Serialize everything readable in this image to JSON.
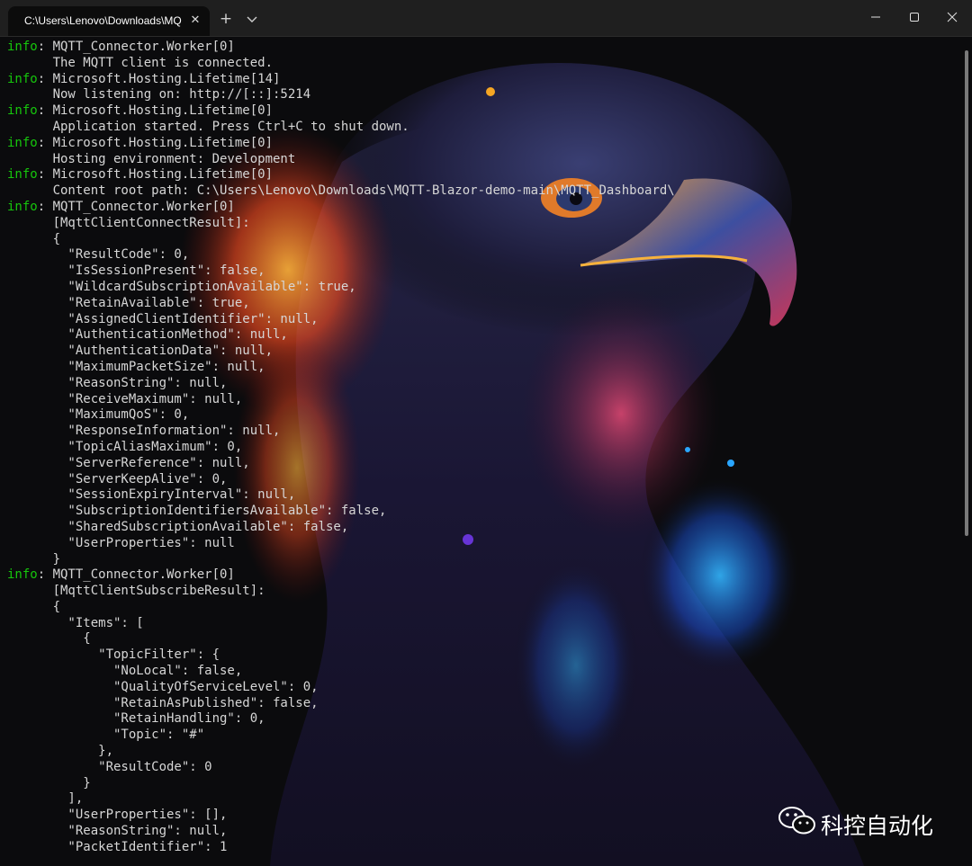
{
  "window": {
    "tab_title": "C:\\Users\\Lenovo\\Downloads\\MQ",
    "tab_close_icon": "close-icon",
    "new_tab_icon": "plus-icon",
    "dropdown_icon": "chevron-down-icon",
    "controls": [
      "minimize-icon",
      "maximize-icon",
      "close-icon"
    ]
  },
  "colors": {
    "titlebar": "#1f1f1f",
    "terminal_bg": "#0b0b0d",
    "log_level": "#16c60c",
    "text": "#d6d6d6"
  },
  "lines": [
    {
      "level": "info",
      "text": ": MQTT_Connector.Worker[0]"
    },
    {
      "level": "",
      "text": "      The MQTT client is connected."
    },
    {
      "level": "info",
      "text": ": Microsoft.Hosting.Lifetime[14]"
    },
    {
      "level": "",
      "text": "      Now listening on: http://[::]:5214"
    },
    {
      "level": "info",
      "text": ": Microsoft.Hosting.Lifetime[0]"
    },
    {
      "level": "",
      "text": "      Application started. Press Ctrl+C to shut down."
    },
    {
      "level": "info",
      "text": ": Microsoft.Hosting.Lifetime[0]"
    },
    {
      "level": "",
      "text": "      Hosting environment: Development"
    },
    {
      "level": "info",
      "text": ": Microsoft.Hosting.Lifetime[0]"
    },
    {
      "level": "",
      "text": "      Content root path: C:\\Users\\Lenovo\\Downloads\\MQTT-Blazor-demo-main\\MQTT_Dashboard\\"
    },
    {
      "level": "info",
      "text": ": MQTT_Connector.Worker[0]"
    },
    {
      "level": "",
      "text": "      [MqttClientConnectResult]:"
    },
    {
      "level": "",
      "text": "      {"
    },
    {
      "level": "",
      "text": "        \"ResultCode\": 0,"
    },
    {
      "level": "",
      "text": "        \"IsSessionPresent\": false,"
    },
    {
      "level": "",
      "text": "        \"WildcardSubscriptionAvailable\": true,"
    },
    {
      "level": "",
      "text": "        \"RetainAvailable\": true,"
    },
    {
      "level": "",
      "text": "        \"AssignedClientIdentifier\": null,"
    },
    {
      "level": "",
      "text": "        \"AuthenticationMethod\": null,"
    },
    {
      "level": "",
      "text": "        \"AuthenticationData\": null,"
    },
    {
      "level": "",
      "text": "        \"MaximumPacketSize\": null,"
    },
    {
      "level": "",
      "text": "        \"ReasonString\": null,"
    },
    {
      "level": "",
      "text": "        \"ReceiveMaximum\": null,"
    },
    {
      "level": "",
      "text": "        \"MaximumQoS\": 0,"
    },
    {
      "level": "",
      "text": "        \"ResponseInformation\": null,"
    },
    {
      "level": "",
      "text": "        \"TopicAliasMaximum\": 0,"
    },
    {
      "level": "",
      "text": "        \"ServerReference\": null,"
    },
    {
      "level": "",
      "text": "        \"ServerKeepAlive\": 0,"
    },
    {
      "level": "",
      "text": "        \"SessionExpiryInterval\": null,"
    },
    {
      "level": "",
      "text": "        \"SubscriptionIdentifiersAvailable\": false,"
    },
    {
      "level": "",
      "text": "        \"SharedSubscriptionAvailable\": false,"
    },
    {
      "level": "",
      "text": "        \"UserProperties\": null"
    },
    {
      "level": "",
      "text": "      }"
    },
    {
      "level": "info",
      "text": ": MQTT_Connector.Worker[0]"
    },
    {
      "level": "",
      "text": "      [MqttClientSubscribeResult]:"
    },
    {
      "level": "",
      "text": "      {"
    },
    {
      "level": "",
      "text": "        \"Items\": ["
    },
    {
      "level": "",
      "text": "          {"
    },
    {
      "level": "",
      "text": "            \"TopicFilter\": {"
    },
    {
      "level": "",
      "text": "              \"NoLocal\": false,"
    },
    {
      "level": "",
      "text": "              \"QualityOfServiceLevel\": 0,"
    },
    {
      "level": "",
      "text": "              \"RetainAsPublished\": false,"
    },
    {
      "level": "",
      "text": "              \"RetainHandling\": 0,"
    },
    {
      "level": "",
      "text": "              \"Topic\": \"#\""
    },
    {
      "level": "",
      "text": "            },"
    },
    {
      "level": "",
      "text": "            \"ResultCode\": 0"
    },
    {
      "level": "",
      "text": "          }"
    },
    {
      "level": "",
      "text": "        ],"
    },
    {
      "level": "",
      "text": "        \"UserProperties\": [],"
    },
    {
      "level": "",
      "text": "        \"ReasonString\": null,"
    },
    {
      "level": "",
      "text": "        \"PacketIdentifier\": 1"
    }
  ],
  "watermark": {
    "icon": "wechat-icon",
    "text": "科控自动化"
  },
  "background": {
    "image": "eagle-artwork"
  }
}
